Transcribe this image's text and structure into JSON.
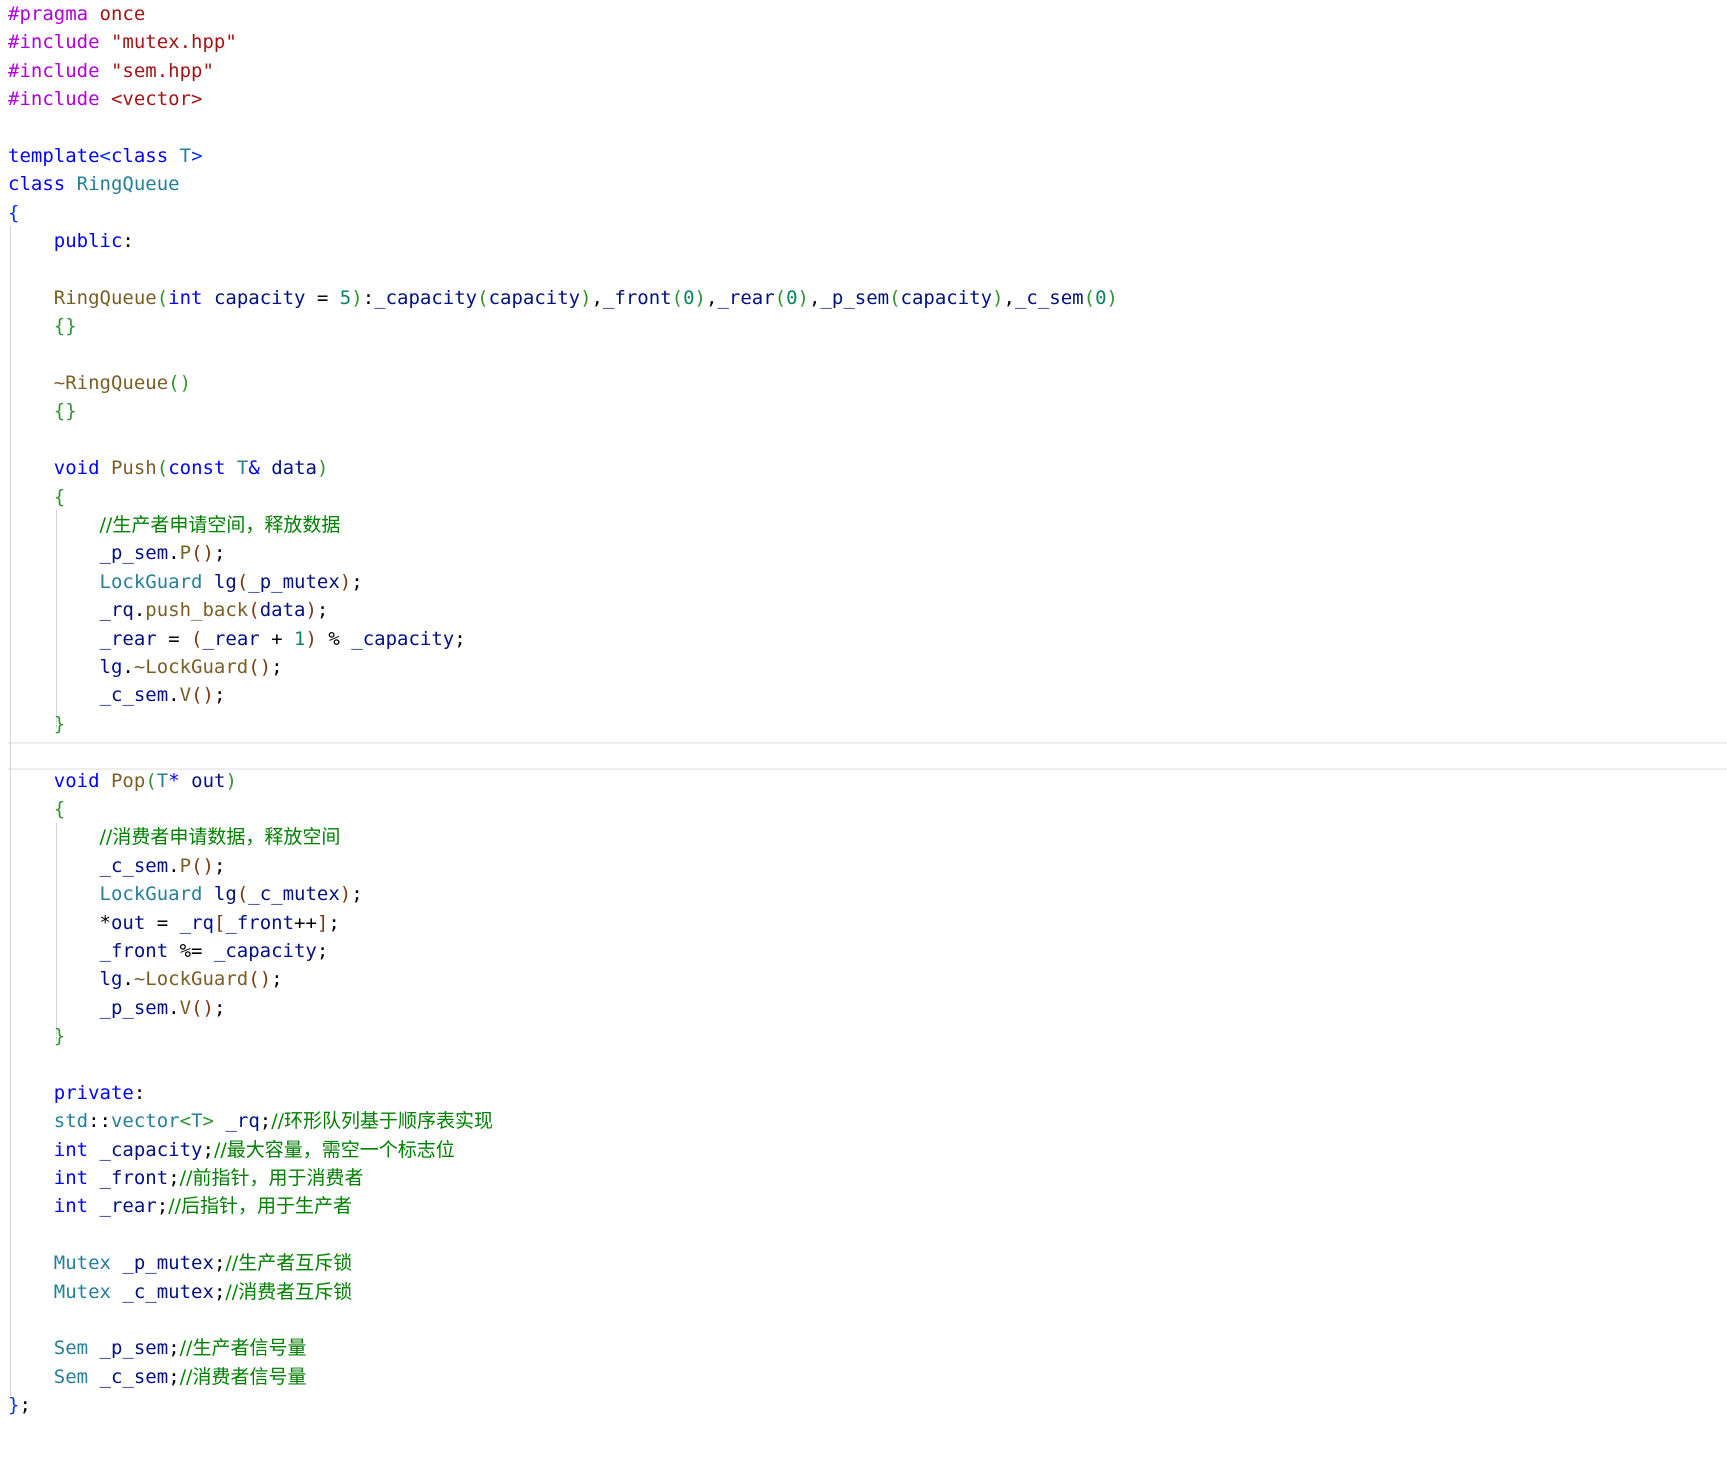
{
  "editor": {
    "language": "cpp",
    "active_line": 27,
    "colors": {
      "background": "#ffffff",
      "directive": "#af00db",
      "keyword": "#0000ff",
      "string": "#a31515",
      "type": "#267f99",
      "function": "#795e26",
      "variable": "#001080",
      "number": "#098658",
      "comment": "#008000",
      "bracket_level1": "#0431fa",
      "bracket_level2": "#319331",
      "bracket_level3": "#7b3814"
    },
    "lines": [
      [
        [
          "t-dir",
          "#pragma"
        ],
        [
          "t-op",
          " "
        ],
        [
          "t-str",
          "once"
        ]
      ],
      [
        [
          "t-dir",
          "#include"
        ],
        [
          "t-op",
          " "
        ],
        [
          "t-str",
          "\"mutex.hpp\""
        ]
      ],
      [
        [
          "t-dir",
          "#include"
        ],
        [
          "t-op",
          " "
        ],
        [
          "t-str",
          "\"sem.hpp\""
        ]
      ],
      [
        [
          "t-dir",
          "#include"
        ],
        [
          "t-op",
          " "
        ],
        [
          "t-str",
          "<vector>"
        ]
      ],
      [],
      [
        [
          "t-kw",
          "template"
        ],
        [
          "b1",
          "<"
        ],
        [
          "t-kw",
          "class"
        ],
        [
          "t-op",
          " "
        ],
        [
          "t-type",
          "T"
        ],
        [
          "b1",
          ">"
        ]
      ],
      [
        [
          "t-kw",
          "class"
        ],
        [
          "t-op",
          " "
        ],
        [
          "t-type",
          "RingQueue"
        ]
      ],
      [
        [
          "b1",
          "{"
        ]
      ],
      [
        [
          "t-op",
          "    "
        ],
        [
          "t-kw",
          "public"
        ],
        [
          "t-op",
          ":"
        ]
      ],
      [],
      [
        [
          "t-op",
          "    "
        ],
        [
          "t-fn",
          "RingQueue"
        ],
        [
          "b2",
          "("
        ],
        [
          "t-kw",
          "int"
        ],
        [
          "t-op",
          " "
        ],
        [
          "t-var",
          "capacity"
        ],
        [
          "t-op",
          " = "
        ],
        [
          "t-num",
          "5"
        ],
        [
          "b2",
          ")"
        ],
        [
          "t-op",
          ":"
        ],
        [
          "t-var",
          "_capacity"
        ],
        [
          "b2",
          "("
        ],
        [
          "t-var",
          "capacity"
        ],
        [
          "b2",
          ")"
        ],
        [
          "t-op",
          ","
        ],
        [
          "t-var",
          "_front"
        ],
        [
          "b2",
          "("
        ],
        [
          "t-num",
          "0"
        ],
        [
          "b2",
          ")"
        ],
        [
          "t-op",
          ","
        ],
        [
          "t-var",
          "_rear"
        ],
        [
          "b2",
          "("
        ],
        [
          "t-num",
          "0"
        ],
        [
          "b2",
          ")"
        ],
        [
          "t-op",
          ","
        ],
        [
          "t-var",
          "_p_sem"
        ],
        [
          "b2",
          "("
        ],
        [
          "t-var",
          "capacity"
        ],
        [
          "b2",
          ")"
        ],
        [
          "t-op",
          ","
        ],
        [
          "t-var",
          "_c_sem"
        ],
        [
          "b2",
          "("
        ],
        [
          "t-num",
          "0"
        ],
        [
          "b2",
          ")"
        ]
      ],
      [
        [
          "t-op",
          "    "
        ],
        [
          "b2",
          "{}"
        ]
      ],
      [],
      [
        [
          "t-op",
          "    "
        ],
        [
          "t-fn",
          "~RingQueue"
        ],
        [
          "b2",
          "()"
        ]
      ],
      [
        [
          "t-op",
          "    "
        ],
        [
          "b2",
          "{}"
        ]
      ],
      [],
      [
        [
          "t-op",
          "    "
        ],
        [
          "t-kw",
          "void"
        ],
        [
          "t-op",
          " "
        ],
        [
          "t-fn",
          "Push"
        ],
        [
          "b2",
          "("
        ],
        [
          "t-kw",
          "const"
        ],
        [
          "t-op",
          " "
        ],
        [
          "t-type",
          "T"
        ],
        [
          "t-kw",
          "&"
        ],
        [
          "t-op",
          " "
        ],
        [
          "t-var",
          "data"
        ],
        [
          "b2",
          ")"
        ]
      ],
      [
        [
          "t-op",
          "    "
        ],
        [
          "b2",
          "{"
        ]
      ],
      [
        [
          "t-op",
          "        "
        ],
        [
          "t-com",
          "//生产者申请空间，释放数据"
        ]
      ],
      [
        [
          "t-op",
          "        "
        ],
        [
          "t-var",
          "_p_sem"
        ],
        [
          "t-op",
          "."
        ],
        [
          "t-fn",
          "P"
        ],
        [
          "b3",
          "()"
        ],
        [
          "t-op",
          ";"
        ]
      ],
      [
        [
          "t-op",
          "        "
        ],
        [
          "t-type",
          "LockGuard"
        ],
        [
          "t-op",
          " "
        ],
        [
          "t-var",
          "lg"
        ],
        [
          "b3",
          "("
        ],
        [
          "t-var",
          "_p_mutex"
        ],
        [
          "b3",
          ")"
        ],
        [
          "t-op",
          ";"
        ]
      ],
      [
        [
          "t-op",
          "        "
        ],
        [
          "t-var",
          "_rq"
        ],
        [
          "t-op",
          "."
        ],
        [
          "t-fn",
          "push_back"
        ],
        [
          "b3",
          "("
        ],
        [
          "t-var",
          "data"
        ],
        [
          "b3",
          ")"
        ],
        [
          "t-op",
          ";"
        ]
      ],
      [
        [
          "t-op",
          "        "
        ],
        [
          "t-var",
          "_rear"
        ],
        [
          "t-op",
          " = "
        ],
        [
          "b3",
          "("
        ],
        [
          "t-var",
          "_rear"
        ],
        [
          "t-op",
          " + "
        ],
        [
          "t-num",
          "1"
        ],
        [
          "b3",
          ")"
        ],
        [
          "t-op",
          " % "
        ],
        [
          "t-var",
          "_capacity"
        ],
        [
          "t-op",
          ";"
        ]
      ],
      [
        [
          "t-op",
          "        "
        ],
        [
          "t-var",
          "lg"
        ],
        [
          "t-op",
          "."
        ],
        [
          "t-fn",
          "~LockGuard"
        ],
        [
          "b3",
          "()"
        ],
        [
          "t-op",
          ";"
        ]
      ],
      [
        [
          "t-op",
          "        "
        ],
        [
          "t-var",
          "_c_sem"
        ],
        [
          "t-op",
          "."
        ],
        [
          "t-fn",
          "V"
        ],
        [
          "b3",
          "()"
        ],
        [
          "t-op",
          ";"
        ]
      ],
      [
        [
          "t-op",
          "    "
        ],
        [
          "b2",
          "}"
        ]
      ],
      [],
      [
        [
          "t-op",
          "    "
        ],
        [
          "t-kw",
          "void"
        ],
        [
          "t-op",
          " "
        ],
        [
          "t-fn",
          "Pop"
        ],
        [
          "b2",
          "("
        ],
        [
          "t-type",
          "T"
        ],
        [
          "t-kw",
          "*"
        ],
        [
          "t-op",
          " "
        ],
        [
          "t-var",
          "out"
        ],
        [
          "b2",
          ")"
        ]
      ],
      [
        [
          "t-op",
          "    "
        ],
        [
          "b2",
          "{"
        ]
      ],
      [
        [
          "t-op",
          "        "
        ],
        [
          "t-com",
          "//消费者申请数据，释放空间"
        ]
      ],
      [
        [
          "t-op",
          "        "
        ],
        [
          "t-var",
          "_c_sem"
        ],
        [
          "t-op",
          "."
        ],
        [
          "t-fn",
          "P"
        ],
        [
          "b3",
          "()"
        ],
        [
          "t-op",
          ";"
        ]
      ],
      [
        [
          "t-op",
          "        "
        ],
        [
          "t-type",
          "LockGuard"
        ],
        [
          "t-op",
          " "
        ],
        [
          "t-var",
          "lg"
        ],
        [
          "b3",
          "("
        ],
        [
          "t-var",
          "_c_mutex"
        ],
        [
          "b3",
          ")"
        ],
        [
          "t-op",
          ";"
        ]
      ],
      [
        [
          "t-op",
          "        *"
        ],
        [
          "t-var",
          "out"
        ],
        [
          "t-op",
          " = "
        ],
        [
          "t-var",
          "_rq"
        ],
        [
          "b3",
          "["
        ],
        [
          "t-var",
          "_front"
        ],
        [
          "t-op",
          "++"
        ],
        [
          "b3",
          "]"
        ],
        [
          "t-op",
          ";"
        ]
      ],
      [
        [
          "t-op",
          "        "
        ],
        [
          "t-var",
          "_front"
        ],
        [
          "t-op",
          " %= "
        ],
        [
          "t-var",
          "_capacity"
        ],
        [
          "t-op",
          ";"
        ]
      ],
      [
        [
          "t-op",
          "        "
        ],
        [
          "t-var",
          "lg"
        ],
        [
          "t-op",
          "."
        ],
        [
          "t-fn",
          "~LockGuard"
        ],
        [
          "b3",
          "()"
        ],
        [
          "t-op",
          ";"
        ]
      ],
      [
        [
          "t-op",
          "        "
        ],
        [
          "t-var",
          "_p_sem"
        ],
        [
          "t-op",
          "."
        ],
        [
          "t-fn",
          "V"
        ],
        [
          "b3",
          "()"
        ],
        [
          "t-op",
          ";"
        ]
      ],
      [
        [
          "t-op",
          "    "
        ],
        [
          "b2",
          "}"
        ]
      ],
      [],
      [
        [
          "t-op",
          "    "
        ],
        [
          "t-kw",
          "private"
        ],
        [
          "t-op",
          ":"
        ]
      ],
      [
        [
          "t-op",
          "    "
        ],
        [
          "t-type",
          "std"
        ],
        [
          "t-op",
          "::"
        ],
        [
          "t-type",
          "vector"
        ],
        [
          "b2",
          "<"
        ],
        [
          "t-type",
          "T"
        ],
        [
          "b2",
          ">"
        ],
        [
          "t-op",
          " "
        ],
        [
          "t-var",
          "_rq"
        ],
        [
          "t-op",
          ";"
        ],
        [
          "t-com",
          "//环形队列基于顺序表实现"
        ]
      ],
      [
        [
          "t-op",
          "    "
        ],
        [
          "t-kw",
          "int"
        ],
        [
          "t-op",
          " "
        ],
        [
          "t-var",
          "_capacity"
        ],
        [
          "t-op",
          ";"
        ],
        [
          "t-com",
          "//最大容量，需空一个标志位"
        ]
      ],
      [
        [
          "t-op",
          "    "
        ],
        [
          "t-kw",
          "int"
        ],
        [
          "t-op",
          " "
        ],
        [
          "t-var",
          "_front"
        ],
        [
          "t-op",
          ";"
        ],
        [
          "t-com",
          "//前指针，用于消费者"
        ]
      ],
      [
        [
          "t-op",
          "    "
        ],
        [
          "t-kw",
          "int"
        ],
        [
          "t-op",
          " "
        ],
        [
          "t-var",
          "_rear"
        ],
        [
          "t-op",
          ";"
        ],
        [
          "t-com",
          "//后指针，用于生产者"
        ]
      ],
      [],
      [
        [
          "t-op",
          "    "
        ],
        [
          "t-type",
          "Mutex"
        ],
        [
          "t-op",
          " "
        ],
        [
          "t-var",
          "_p_mutex"
        ],
        [
          "t-op",
          ";"
        ],
        [
          "t-com",
          "//生产者互斥锁"
        ]
      ],
      [
        [
          "t-op",
          "    "
        ],
        [
          "t-type",
          "Mutex"
        ],
        [
          "t-op",
          " "
        ],
        [
          "t-var",
          "_c_mutex"
        ],
        [
          "t-op",
          ";"
        ],
        [
          "t-com",
          "//消费者互斥锁"
        ]
      ],
      [],
      [
        [
          "t-op",
          "    "
        ],
        [
          "t-type",
          "Sem"
        ],
        [
          "t-op",
          " "
        ],
        [
          "t-var",
          "_p_sem"
        ],
        [
          "t-op",
          ";"
        ],
        [
          "t-com",
          "//生产者信号量"
        ]
      ],
      [
        [
          "t-op",
          "    "
        ],
        [
          "t-type",
          "Sem"
        ],
        [
          "t-op",
          " "
        ],
        [
          "t-var",
          "_c_sem"
        ],
        [
          "t-op",
          ";"
        ],
        [
          "t-com",
          "//消费者信号量"
        ]
      ],
      [
        [
          "b1",
          "}"
        ],
        [
          "t-op",
          ";"
        ]
      ]
    ]
  }
}
